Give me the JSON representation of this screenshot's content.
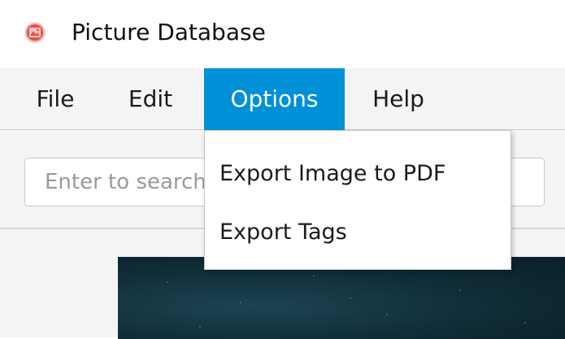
{
  "window": {
    "title": "Picture Database",
    "icon": "picture-app-icon"
  },
  "menubar": {
    "items": [
      {
        "label": "File"
      },
      {
        "label": "Edit"
      },
      {
        "label": "Options",
        "active": true
      },
      {
        "label": "Help"
      }
    ],
    "active_color": "#0090d7"
  },
  "search": {
    "placeholder": "Enter to search"
  },
  "options_menu": {
    "items": [
      {
        "label": "Export Image to PDF"
      },
      {
        "label": "Export Tags"
      }
    ]
  }
}
